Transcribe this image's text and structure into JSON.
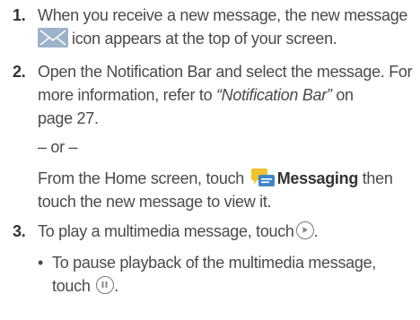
{
  "steps": [
    {
      "number": "1.",
      "line1": "When you receive a new message, the new message",
      "line2_after_icon": "icon appears at the top of your screen."
    },
    {
      "number": "2.",
      "line1": "Open the Notification Bar and select the message. For",
      "line2_a": "more information, refer to ",
      "line2_em": "“Notification Bar”",
      "line2_b": " on",
      "line3": "page 27.",
      "or": "– or –",
      "alt_a": "From the Home screen, touch ",
      "alt_bold": "Messaging",
      "alt_b": " then",
      "alt_line2": "touch the new message to view it."
    },
    {
      "number": "3.",
      "line1": "To play a multimedia message, touch",
      "line1_end": ".",
      "bullet": "•",
      "sub_line1": "To pause playback of the multimedia message,",
      "sub_line2": "touch",
      "sub_line2_end": "."
    }
  ],
  "icons": {
    "new_message": "envelope-icon",
    "messaging_app": "messaging-app-icon",
    "play": "play-icon",
    "pause": "pause-icon"
  },
  "colors": {
    "text": "#4a4a4a",
    "envelope_bg": "#9db3c9",
    "app_yellow": "#f2c12e",
    "app_blue": "#3f86c9"
  }
}
